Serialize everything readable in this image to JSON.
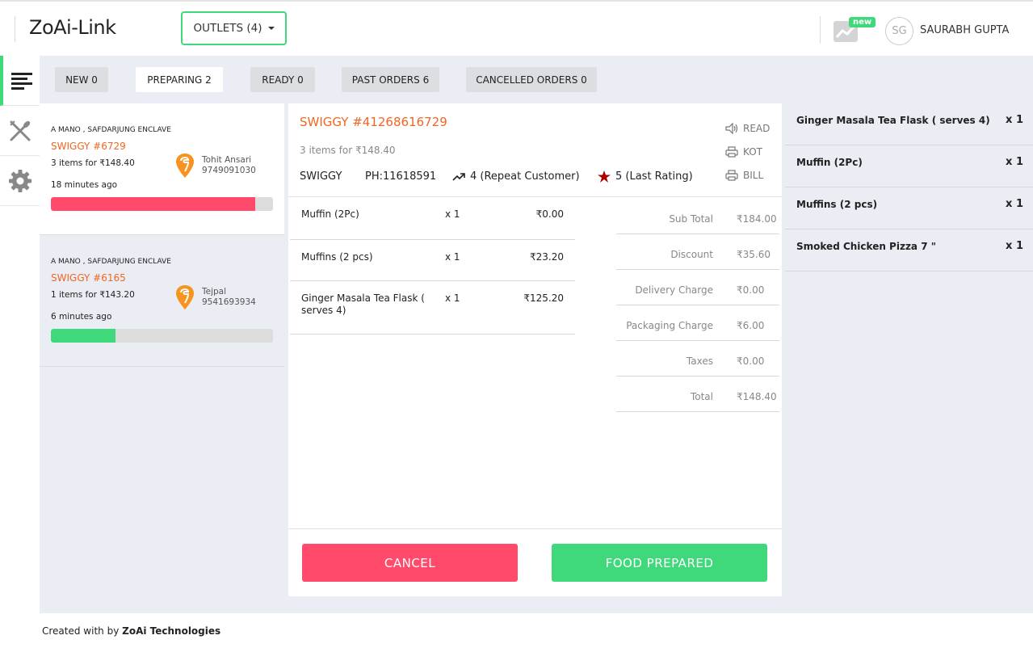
{
  "header": {
    "brand": "ZoAi-Link",
    "outlets_label": "OUTLETS (4)",
    "analytics_badge": "new",
    "avatar_initials": "SG",
    "user_name": "SAURABH GUPTA"
  },
  "nav": [
    {
      "icon": "orders-list-icon",
      "active": true
    },
    {
      "icon": "restaurant-menu-icon",
      "active": false
    },
    {
      "icon": "settings-gear-icon",
      "active": false
    }
  ],
  "tabs": [
    {
      "label": "NEW 0"
    },
    {
      "label": "PREPARING 2"
    },
    {
      "label": "READY 0"
    },
    {
      "label": "PAST ORDERS 6"
    },
    {
      "label": "CANCELLED ORDERS 0"
    }
  ],
  "orders": [
    {
      "outlet": "A MANO , SAFDARJUNG ENCLAVE",
      "order_id": "SWIGGY #6729",
      "items_summary": "3 items for ₹148.40",
      "customer_name": "Tohit Ansari",
      "customer_phone": "9749091030",
      "time_ago": "18 minutes ago",
      "progress": 0.92
    },
    {
      "outlet": "A MANO , SAFDARJUNG ENCLAVE",
      "order_id": "SWIGGY #6165",
      "items_summary": "1 items for ₹143.20",
      "customer_name": "Tejpal",
      "customer_phone": "9541693934",
      "time_ago": "6 minutes ago",
      "progress": 0.29
    }
  ],
  "detail": {
    "order_id": "SWIGGY #41268616729",
    "items_summary": "3 items for ₹148.40",
    "source": "SWIGGY",
    "phone": "PH:11618591",
    "repeat": "4 (Repeat Customer)",
    "rating": "5 (Last Rating)",
    "actions": {
      "read": "READ",
      "kot": "KOT",
      "bill": "BILL"
    },
    "items": [
      {
        "name": "Muffin (2Pc)",
        "qty": "x 1",
        "price": "₹0.00"
      },
      {
        "name": "Muffins (2 pcs)",
        "qty": "x 1",
        "price": "₹23.20"
      },
      {
        "name": "Ginger Masala Tea Flask ( serves 4)",
        "qty": "x 1",
        "price": "₹125.20"
      }
    ],
    "bill": [
      {
        "label": "Sub Total",
        "value": "₹184.00"
      },
      {
        "label": "Discount",
        "value": "₹35.60"
      },
      {
        "label": "Delivery Charge",
        "value": "₹0.00"
      },
      {
        "label": "Packaging Charge",
        "value": "₹6.00"
      },
      {
        "label": "Taxes",
        "value": "₹0.00"
      },
      {
        "label": "Total",
        "value": "₹148.40"
      }
    ],
    "cancel_label": "CANCEL",
    "prepared_label": "FOOD PREPARED"
  },
  "kitchen_summary": [
    {
      "name": "Ginger Masala Tea Flask ( serves 4)",
      "qty": "x 1"
    },
    {
      "name": "Muffin (2Pc)",
      "qty": "x 1"
    },
    {
      "name": "Muffins (2 pcs)",
      "qty": "x 1"
    },
    {
      "name": "Smoked Chicken Pizza 7 \"",
      "qty": "x 1"
    }
  ],
  "footer": {
    "prefix": "Created with by",
    "company": "ZoAi Technologies"
  },
  "colors": {
    "accent": "#3fd87a",
    "danger": "#ff4a6b",
    "swiggy": "#f26522"
  }
}
